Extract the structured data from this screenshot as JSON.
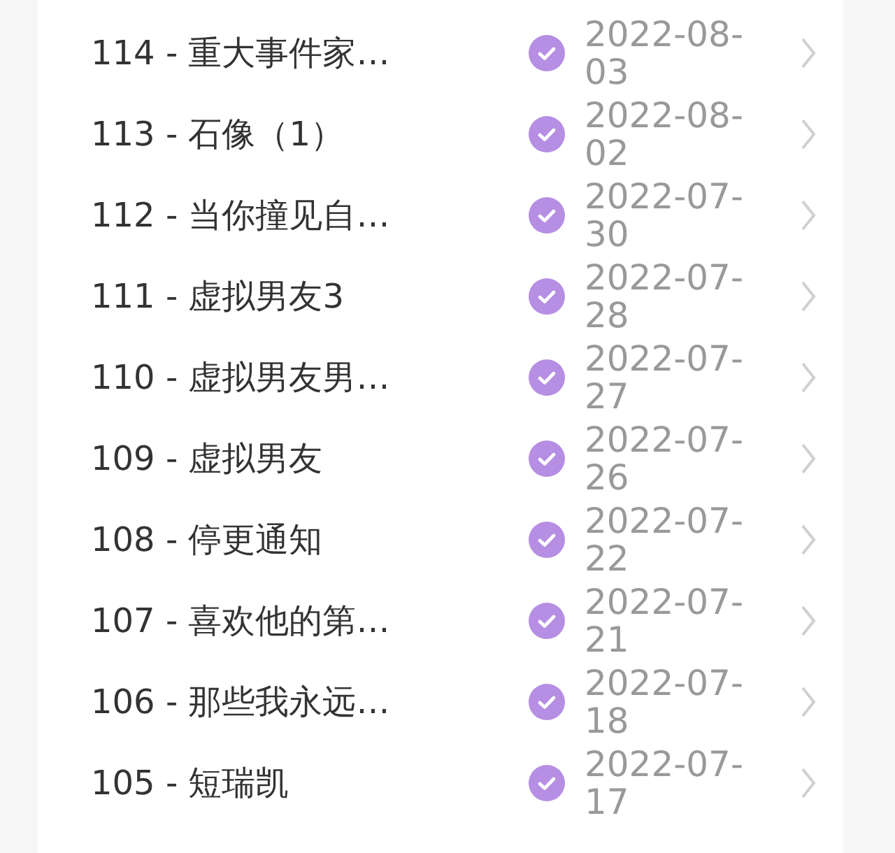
{
  "chapters": [
    {
      "title": "114 - 重大事件家…",
      "done": true,
      "date": "2022-08-03"
    },
    {
      "title": "113 - 石像（1）",
      "done": true,
      "date": "2022-08-02"
    },
    {
      "title": "112 - 当你撞见自…",
      "done": true,
      "date": "2022-07-30"
    },
    {
      "title": "111 - 虚拟男友3",
      "done": true,
      "date": "2022-07-28"
    },
    {
      "title": "110 - 虚拟男友男…",
      "done": true,
      "date": "2022-07-27"
    },
    {
      "title": "109 - 虚拟男友",
      "done": true,
      "date": "2022-07-26"
    },
    {
      "title": "108 - 停更通知",
      "done": true,
      "date": "2022-07-22"
    },
    {
      "title": "107 - 喜欢他的第…",
      "done": true,
      "date": "2022-07-21"
    },
    {
      "title": "106 - 那些我永远…",
      "done": true,
      "date": "2022-07-18"
    },
    {
      "title": "105 - 短瑞凯",
      "done": true,
      "date": "2022-07-17"
    }
  ]
}
